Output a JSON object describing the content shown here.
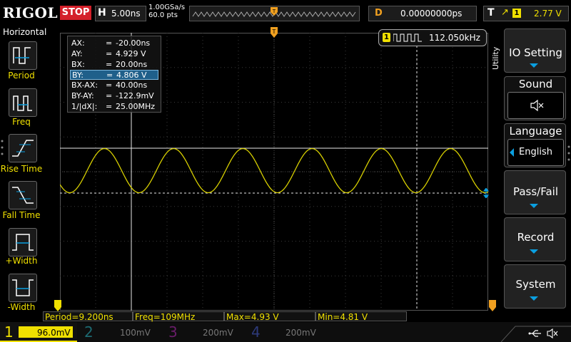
{
  "topbar": {
    "brand": "RIGOL",
    "run_state": "STOP",
    "horizontal_letter": "H",
    "timebase": "5.00ns",
    "sample_rate": "1.00GSa/s",
    "memory_depth": "60.0 pts",
    "delay_letter": "D",
    "delay_value": "0.00000000ps",
    "trigger_letter": "T",
    "trigger_source": "1",
    "trigger_level": "2.77 V"
  },
  "left_menu": {
    "title": "Horizontal",
    "items": [
      {
        "label": "Period",
        "icon": "period-icon"
      },
      {
        "label": "Freq",
        "icon": "freq-icon"
      },
      {
        "label": "Rise Time",
        "icon": "rise-time-icon"
      },
      {
        "label": "Fall Time",
        "icon": "fall-time-icon"
      },
      {
        "label": "+Width",
        "icon": "positive-width-icon"
      },
      {
        "label": "-Width",
        "icon": "negative-width-icon"
      }
    ]
  },
  "cursors": {
    "rows": [
      {
        "name": "AX:",
        "eq": "=",
        "value": "-20.00ns"
      },
      {
        "name": "AY:",
        "eq": "=",
        "value": "4.929 V"
      },
      {
        "name": "BX:",
        "eq": "=",
        "value": "20.00ns"
      },
      {
        "name": "BY:",
        "eq": "=",
        "value": "4.806 V"
      },
      {
        "name": "BX-AX:",
        "eq": "=",
        "value": "40.00ns"
      },
      {
        "name": "BY-AY:",
        "eq": "=",
        "value": "-122.9mV"
      },
      {
        "name": "1/|dX|:",
        "eq": "=",
        "value": "25.00MHz"
      }
    ],
    "selected_row": "BY:"
  },
  "frequency_counter": {
    "channel": "1",
    "value": "112.050kHz"
  },
  "right_menu": {
    "side_label": "Utility",
    "items": [
      {
        "label": "IO Setting",
        "sub": ""
      },
      {
        "label": "Sound",
        "sub": "speaker-muted-icon"
      },
      {
        "label": "Language",
        "sub": "English"
      },
      {
        "label": "Pass/Fail",
        "sub": ""
      },
      {
        "label": "Record",
        "sub": ""
      },
      {
        "label": "System",
        "sub": ""
      }
    ]
  },
  "measurements": [
    "Period=9.200ns",
    "Freq=109MHz",
    "Max=4.93 V",
    "Min=4.81 V"
  ],
  "channels": [
    {
      "num": "1",
      "scale": "96.0mV",
      "color": "#f0e000",
      "active": true
    },
    {
      "num": "2",
      "scale": "100mV",
      "color": "#00c8d8",
      "active": false
    },
    {
      "num": "3",
      "scale": "200mV",
      "color": "#e020e0",
      "active": false
    },
    {
      "num": "4",
      "scale": "200mV",
      "color": "#2060f0",
      "active": false
    }
  ],
  "colors": {
    "ch1": "#f0e000",
    "accent": "#0a9fe0",
    "stop": "#d4202a",
    "trigger_marker": "#f0a020"
  }
}
